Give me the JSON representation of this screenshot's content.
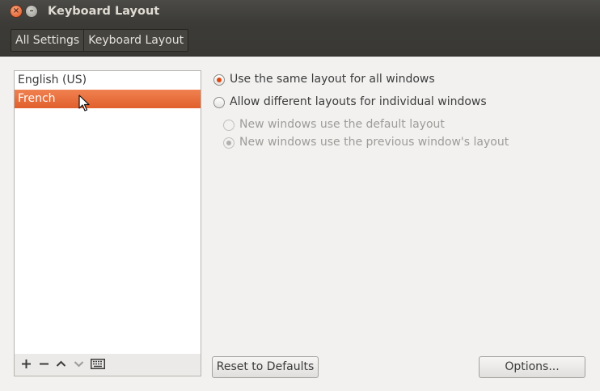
{
  "window": {
    "title": "Keyboard Layout"
  },
  "breadcrumb": {
    "items": [
      "All Settings",
      "Keyboard Layout"
    ]
  },
  "layouts": {
    "items": [
      "English (US)",
      "French"
    ],
    "selected": "French"
  },
  "list_toolbar": {
    "icons": [
      "add-icon",
      "remove-icon",
      "move-up-icon",
      "move-down-icon",
      "keyboard-icon"
    ]
  },
  "options": {
    "same_layout": "Use the same layout for all windows",
    "different_layouts": "Allow different layouts for individual windows",
    "default_layout": "New windows use the default layout",
    "previous_layout": "New windows use the previous window's layout",
    "selected": "same_layout"
  },
  "buttons": {
    "reset": "Reset to Defaults",
    "options": "Options..."
  },
  "colors": {
    "accent": "#dd4814",
    "selection": "#e8693a",
    "titlebar": "#3c3b37"
  }
}
